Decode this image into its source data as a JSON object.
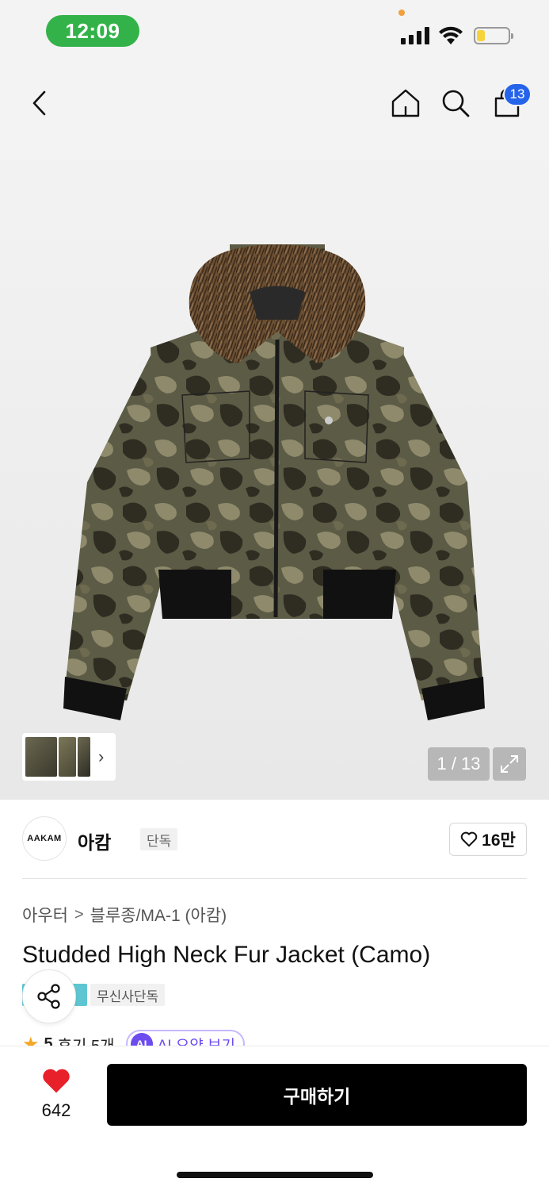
{
  "status_bar": {
    "time": "12:09",
    "battery_level_fraction": 0.25
  },
  "nav": {
    "back_icon": "chevron-left-icon",
    "home_icon": "home-icon",
    "search_icon": "search-icon",
    "cart_icon": "shopping-bag-icon",
    "cart_count": "13"
  },
  "gallery": {
    "counter": "1 / 13",
    "expand_icon": "expand-icon",
    "thumbnail_chevron": "›"
  },
  "brand": {
    "logo_text": "AAKAM",
    "name": "아캄",
    "tag": "단독",
    "like_count": "16만"
  },
  "product": {
    "breadcrumb": [
      "아우터",
      "블루종/MA-1 (아캄)"
    ],
    "breadcrumb_separator": ">",
    "title": "Studded High Neck Fur Jacket (Camo)",
    "tag_exclusive": "무신사단독",
    "rating": "5",
    "reviews": "후기 5개",
    "ai_badge": "AI",
    "ai_summary": "AI 요약 보기"
  },
  "bottom_bar": {
    "like_count": "642",
    "buy_label": "구매하기"
  },
  "colors": {
    "status_time_bg": "#34b24a",
    "badge_blue": "#2563eb",
    "heart_red": "#e8202a",
    "ai_purple": "#6d4cf0",
    "buy_bg": "#000000"
  }
}
